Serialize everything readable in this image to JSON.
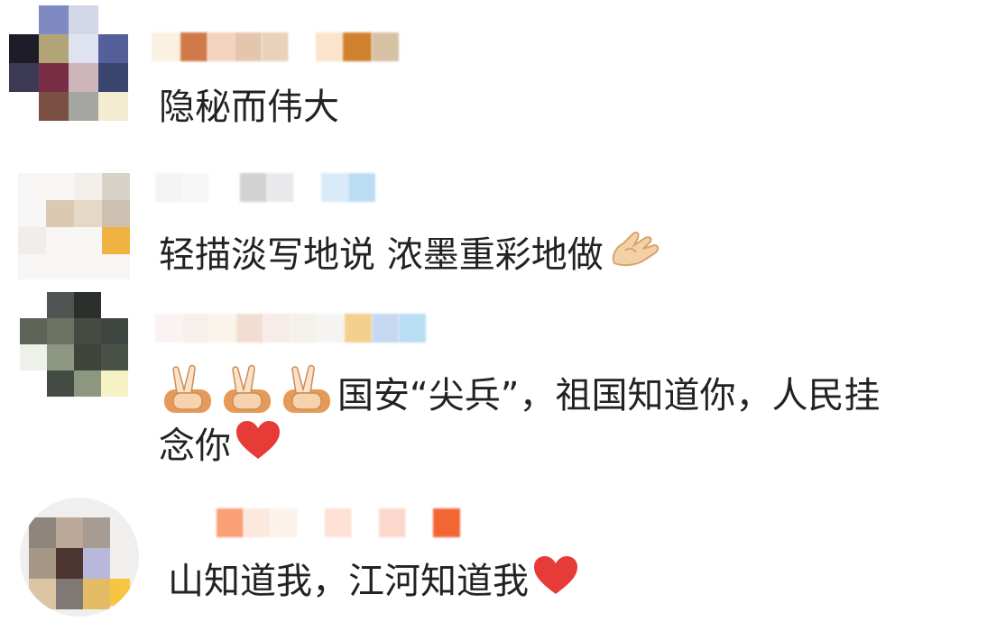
{
  "comments": [
    {
      "text": "隐秘而伟大"
    },
    {
      "text": "轻描淡写地说 浓墨重彩地做",
      "trailing_emoji": "ok-hand-emoji"
    },
    {
      "line1": "国安“尖兵”，祖国知道你，人民挂",
      "line2": "念你",
      "leading_emoji": "victory-hand-emoji",
      "trailing_emoji": "red-heart-emoji"
    },
    {
      "text": "山知道我，江河知道我",
      "trailing_emoji": "red-heart-emoji"
    }
  ],
  "colors": {
    "text": "#222222",
    "heart": "#e63b36",
    "ok_hand": "#f0c89a"
  }
}
